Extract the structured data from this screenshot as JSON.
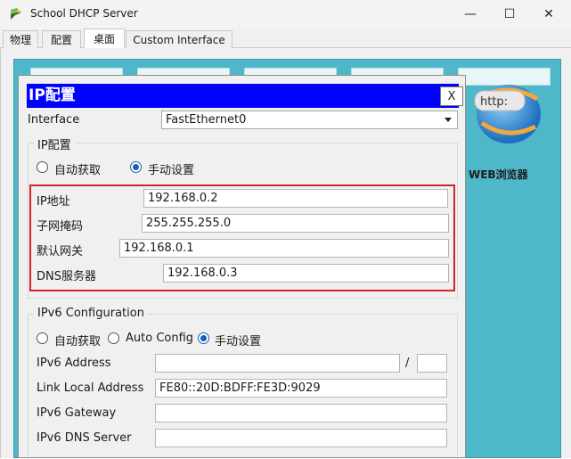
{
  "window": {
    "title": "School DHCP Server",
    "min_glyph": "—",
    "max_glyph": "☐",
    "close_glyph": "✕"
  },
  "tabs": [
    {
      "label": "物理",
      "active": false
    },
    {
      "label": "配置",
      "active": false
    },
    {
      "label": "桌面",
      "active": true
    },
    {
      "label": "Custom Interface",
      "active": false
    }
  ],
  "desktop": {
    "web_browser_label": "WEB浏览器",
    "web_icon_text": "http:"
  },
  "ip_config": {
    "title": "IP配置",
    "close_label": "X",
    "interface_label": "Interface",
    "interface_value": "FastEthernet0",
    "ipv4": {
      "group_title": "IP配置",
      "dhcp_label": "自动获取",
      "static_label": "手动设置",
      "mode": "static",
      "ip_label": "IP地址",
      "ip_value": "192.168.0.2",
      "mask_label": "子网掩码",
      "mask_value": "255.255.255.0",
      "gateway_label": "默认网关",
      "gateway_value": "192.168.0.1",
      "dns_label": "DNS服务器",
      "dns_value": "192.168.0.3"
    },
    "ipv6": {
      "group_title": "IPv6 Configuration",
      "dhcp_label": "自动获取",
      "auto_label": "Auto Config",
      "static_label": "手动设置",
      "mode": "static",
      "address_label": "IPv6 Address",
      "address_value": "",
      "prefix_sep": "/",
      "prefix_value": "",
      "link_local_label": "Link Local Address",
      "link_local_value": "FE80::20D:BDFF:FE3D:9029",
      "gateway_label": "IPv6 Gateway",
      "gateway_value": "",
      "dns_label": "IPv6 DNS Server",
      "dns_value": ""
    }
  },
  "colors": {
    "title_bar_blue": "#0000ff",
    "highlight_red": "#d6232a",
    "desktop_teal": "#4fb7ca"
  }
}
